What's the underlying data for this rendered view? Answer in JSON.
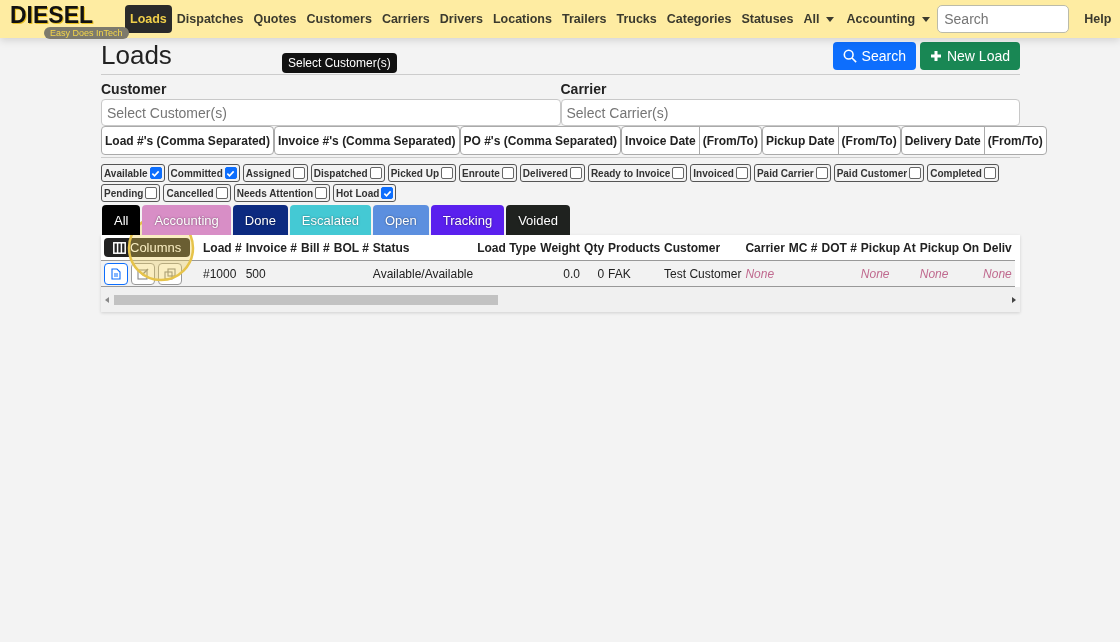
{
  "brand": {
    "logo": "DIESEL",
    "tagline": "Easy Does InTech"
  },
  "nav": {
    "items": [
      {
        "label": "Loads",
        "selected": true
      },
      {
        "label": "Dispatches",
        "selected": false
      },
      {
        "label": "Quotes",
        "selected": false
      },
      {
        "label": "Customers",
        "selected": false
      },
      {
        "label": "Carriers",
        "selected": false
      },
      {
        "label": "Drivers",
        "selected": false
      },
      {
        "label": "Locations",
        "selected": false
      },
      {
        "label": "Trailers",
        "selected": false
      },
      {
        "label": "Trucks",
        "selected": false
      },
      {
        "label": "Categories",
        "selected": false
      },
      {
        "label": "Statuses",
        "selected": false
      }
    ],
    "menus": [
      "All",
      "Accounting"
    ],
    "search": {
      "placeholder": "Search"
    },
    "help": "Help"
  },
  "page": {
    "title": "Loads",
    "buttons": [
      {
        "kind": "search",
        "label": "Search"
      },
      {
        "kind": "new",
        "label": "New Load"
      }
    ]
  },
  "tooltip": "Select Customer(s)",
  "filters": {
    "customer": {
      "label": "Customer",
      "placeholder": "Select Customer(s)"
    },
    "carrier": {
      "label": "Carrier",
      "placeholder": "Select Carrier(s)"
    },
    "fields": [
      {
        "kind": "text",
        "label": "Load #'s (Comma Separated)"
      },
      {
        "kind": "text",
        "label": "Invoice #'s (Comma Separated)"
      },
      {
        "kind": "text",
        "label": "PO #'s (Comma Separated)"
      },
      {
        "kind": "range",
        "label": "Invoice Date",
        "suffix": "(From/To)"
      },
      {
        "kind": "range",
        "label": "Pickup Date",
        "suffix": "(From/To)"
      },
      {
        "kind": "range",
        "label": "Delivery Date",
        "suffix": "(From/To)"
      }
    ]
  },
  "statuses": [
    {
      "label": "Available",
      "checked": true
    },
    {
      "label": "Committed",
      "checked": true
    },
    {
      "label": "Assigned",
      "checked": false
    },
    {
      "label": "Dispatched",
      "checked": false
    },
    {
      "label": "Picked Up",
      "checked": false
    },
    {
      "label": "Enroute",
      "checked": false
    },
    {
      "label": "Delivered",
      "checked": false
    },
    {
      "label": "Ready to Invoice",
      "checked": false
    },
    {
      "label": "Invoiced",
      "checked": false
    },
    {
      "label": "Paid Carrier",
      "checked": false
    },
    {
      "label": "Paid Customer",
      "checked": false
    },
    {
      "label": "Completed",
      "checked": false
    },
    {
      "label": "Pending",
      "checked": false
    },
    {
      "label": "Cancelled",
      "checked": false
    },
    {
      "label": "Needs Attention",
      "checked": false
    },
    {
      "label": "Hot Load",
      "checked": true
    }
  ],
  "tabs": [
    {
      "label": "All",
      "color": "#000000"
    },
    {
      "label": "Accounting",
      "color": "#d88ec6"
    },
    {
      "label": "Done",
      "color": "#0c2a80"
    },
    {
      "label": "Escalated",
      "color": "#44c9d4"
    },
    {
      "label": "Open",
      "color": "#5c8fdf"
    },
    {
      "label": "Tracking",
      "color": "#5a20ee"
    },
    {
      "label": "Voided",
      "color": "#1f221f"
    }
  ],
  "table": {
    "columns_button": "Columns",
    "columns": [
      "Load #",
      "Invoice #",
      "Bill #",
      "BOL #",
      "Status",
      "Load Type",
      "Weight",
      "Qty",
      "Products",
      "Customer",
      "Carrier",
      "MC #",
      "DOT #",
      "Pickup At",
      "Pickup On",
      "Deliv"
    ],
    "rows": [
      {
        "cells": [
          {
            "text": "#1000",
            "missing": false
          },
          {
            "text": "500",
            "missing": false
          },
          null,
          null,
          {
            "text": "Available/Available",
            "missing": false
          },
          null,
          {
            "text": "0.0",
            "missing": false
          },
          {
            "text": "0",
            "missing": false
          },
          {
            "text": "FAK",
            "missing": false
          },
          {
            "text": "Test Customer",
            "missing": false
          },
          {
            "text": "None",
            "missing": true
          },
          null,
          null,
          {
            "text": "None",
            "missing": true
          },
          {
            "text": "None",
            "missing": true
          },
          {
            "text": "None",
            "missing": true
          }
        ]
      }
    ]
  }
}
